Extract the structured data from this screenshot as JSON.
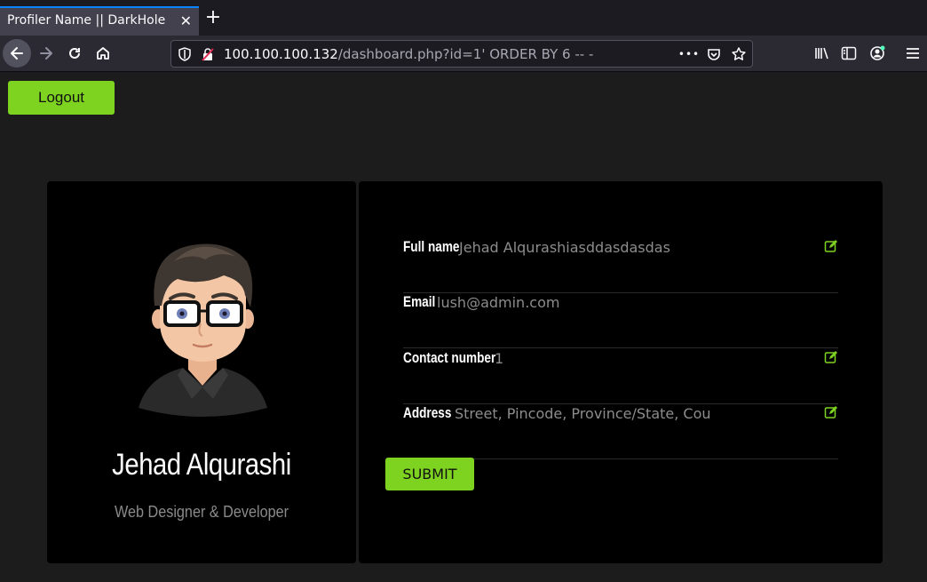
{
  "browser": {
    "tab_title": "Profiler Name || DarkHole",
    "tab_close_glyph": "✕",
    "new_tab_glyph": "+",
    "url_host": "100.100.100.132",
    "url_path": "/dashboard.php?id=1' ORDER BY 6 -- -",
    "url_more_glyph": "•••"
  },
  "header": {
    "logout_label": "Logout"
  },
  "profile": {
    "name": "Jehad Alqurashi",
    "role": "Web Designer & Developer"
  },
  "form": {
    "fields": [
      {
        "label": "Full name",
        "value": "Jehad Alqurashiasddasdasdas",
        "editable": true
      },
      {
        "label": "Email",
        "value": "lush@admin.com",
        "editable": false
      },
      {
        "label": "Contact number",
        "value": "1",
        "editable": true
      },
      {
        "label": "Address",
        "value": "Street, Pincode, Province/State, Cou",
        "editable": true
      }
    ],
    "submit_label": "SUBMIT"
  },
  "colors": {
    "accent": "#7ed321",
    "card_bg": "#000000",
    "page_bg": "#1c1c1c"
  },
  "icons": [
    "back-arrow-icon",
    "forward-arrow-icon",
    "reload-icon",
    "home-icon",
    "shield-icon",
    "insecure-lock-icon",
    "pocket-icon",
    "bookmark-star-icon",
    "library-icon",
    "sidebar-icon",
    "account-icon",
    "menu-icon",
    "edit-icon"
  ]
}
